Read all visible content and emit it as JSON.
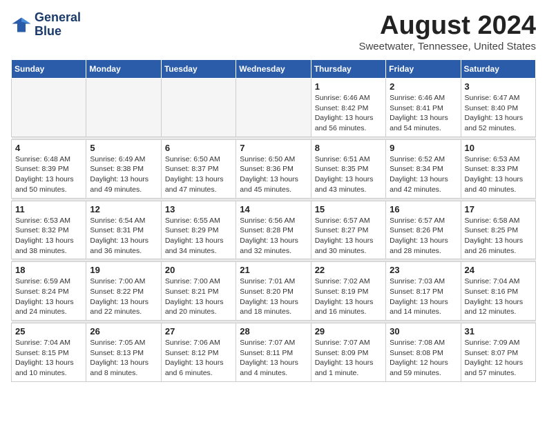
{
  "header": {
    "logo_line1": "General",
    "logo_line2": "Blue",
    "month_title": "August 2024",
    "location": "Sweetwater, Tennessee, United States"
  },
  "days_of_week": [
    "Sunday",
    "Monday",
    "Tuesday",
    "Wednesday",
    "Thursday",
    "Friday",
    "Saturday"
  ],
  "weeks": [
    [
      {
        "day": "",
        "info": ""
      },
      {
        "day": "",
        "info": ""
      },
      {
        "day": "",
        "info": ""
      },
      {
        "day": "",
        "info": ""
      },
      {
        "day": "1",
        "info": "Sunrise: 6:46 AM\nSunset: 8:42 PM\nDaylight: 13 hours\nand 56 minutes."
      },
      {
        "day": "2",
        "info": "Sunrise: 6:46 AM\nSunset: 8:41 PM\nDaylight: 13 hours\nand 54 minutes."
      },
      {
        "day": "3",
        "info": "Sunrise: 6:47 AM\nSunset: 8:40 PM\nDaylight: 13 hours\nand 52 minutes."
      }
    ],
    [
      {
        "day": "4",
        "info": "Sunrise: 6:48 AM\nSunset: 8:39 PM\nDaylight: 13 hours\nand 50 minutes."
      },
      {
        "day": "5",
        "info": "Sunrise: 6:49 AM\nSunset: 8:38 PM\nDaylight: 13 hours\nand 49 minutes."
      },
      {
        "day": "6",
        "info": "Sunrise: 6:50 AM\nSunset: 8:37 PM\nDaylight: 13 hours\nand 47 minutes."
      },
      {
        "day": "7",
        "info": "Sunrise: 6:50 AM\nSunset: 8:36 PM\nDaylight: 13 hours\nand 45 minutes."
      },
      {
        "day": "8",
        "info": "Sunrise: 6:51 AM\nSunset: 8:35 PM\nDaylight: 13 hours\nand 43 minutes."
      },
      {
        "day": "9",
        "info": "Sunrise: 6:52 AM\nSunset: 8:34 PM\nDaylight: 13 hours\nand 42 minutes."
      },
      {
        "day": "10",
        "info": "Sunrise: 6:53 AM\nSunset: 8:33 PM\nDaylight: 13 hours\nand 40 minutes."
      }
    ],
    [
      {
        "day": "11",
        "info": "Sunrise: 6:53 AM\nSunset: 8:32 PM\nDaylight: 13 hours\nand 38 minutes."
      },
      {
        "day": "12",
        "info": "Sunrise: 6:54 AM\nSunset: 8:31 PM\nDaylight: 13 hours\nand 36 minutes."
      },
      {
        "day": "13",
        "info": "Sunrise: 6:55 AM\nSunset: 8:29 PM\nDaylight: 13 hours\nand 34 minutes."
      },
      {
        "day": "14",
        "info": "Sunrise: 6:56 AM\nSunset: 8:28 PM\nDaylight: 13 hours\nand 32 minutes."
      },
      {
        "day": "15",
        "info": "Sunrise: 6:57 AM\nSunset: 8:27 PM\nDaylight: 13 hours\nand 30 minutes."
      },
      {
        "day": "16",
        "info": "Sunrise: 6:57 AM\nSunset: 8:26 PM\nDaylight: 13 hours\nand 28 minutes."
      },
      {
        "day": "17",
        "info": "Sunrise: 6:58 AM\nSunset: 8:25 PM\nDaylight: 13 hours\nand 26 minutes."
      }
    ],
    [
      {
        "day": "18",
        "info": "Sunrise: 6:59 AM\nSunset: 8:24 PM\nDaylight: 13 hours\nand 24 minutes."
      },
      {
        "day": "19",
        "info": "Sunrise: 7:00 AM\nSunset: 8:22 PM\nDaylight: 13 hours\nand 22 minutes."
      },
      {
        "day": "20",
        "info": "Sunrise: 7:00 AM\nSunset: 8:21 PM\nDaylight: 13 hours\nand 20 minutes."
      },
      {
        "day": "21",
        "info": "Sunrise: 7:01 AM\nSunset: 8:20 PM\nDaylight: 13 hours\nand 18 minutes."
      },
      {
        "day": "22",
        "info": "Sunrise: 7:02 AM\nSunset: 8:19 PM\nDaylight: 13 hours\nand 16 minutes."
      },
      {
        "day": "23",
        "info": "Sunrise: 7:03 AM\nSunset: 8:17 PM\nDaylight: 13 hours\nand 14 minutes."
      },
      {
        "day": "24",
        "info": "Sunrise: 7:04 AM\nSunset: 8:16 PM\nDaylight: 13 hours\nand 12 minutes."
      }
    ],
    [
      {
        "day": "25",
        "info": "Sunrise: 7:04 AM\nSunset: 8:15 PM\nDaylight: 13 hours\nand 10 minutes."
      },
      {
        "day": "26",
        "info": "Sunrise: 7:05 AM\nSunset: 8:13 PM\nDaylight: 13 hours\nand 8 minutes."
      },
      {
        "day": "27",
        "info": "Sunrise: 7:06 AM\nSunset: 8:12 PM\nDaylight: 13 hours\nand 6 minutes."
      },
      {
        "day": "28",
        "info": "Sunrise: 7:07 AM\nSunset: 8:11 PM\nDaylight: 13 hours\nand 4 minutes."
      },
      {
        "day": "29",
        "info": "Sunrise: 7:07 AM\nSunset: 8:09 PM\nDaylight: 13 hours\nand 1 minute."
      },
      {
        "day": "30",
        "info": "Sunrise: 7:08 AM\nSunset: 8:08 PM\nDaylight: 12 hours\nand 59 minutes."
      },
      {
        "day": "31",
        "info": "Sunrise: 7:09 AM\nSunset: 8:07 PM\nDaylight: 12 hours\nand 57 minutes."
      }
    ]
  ]
}
